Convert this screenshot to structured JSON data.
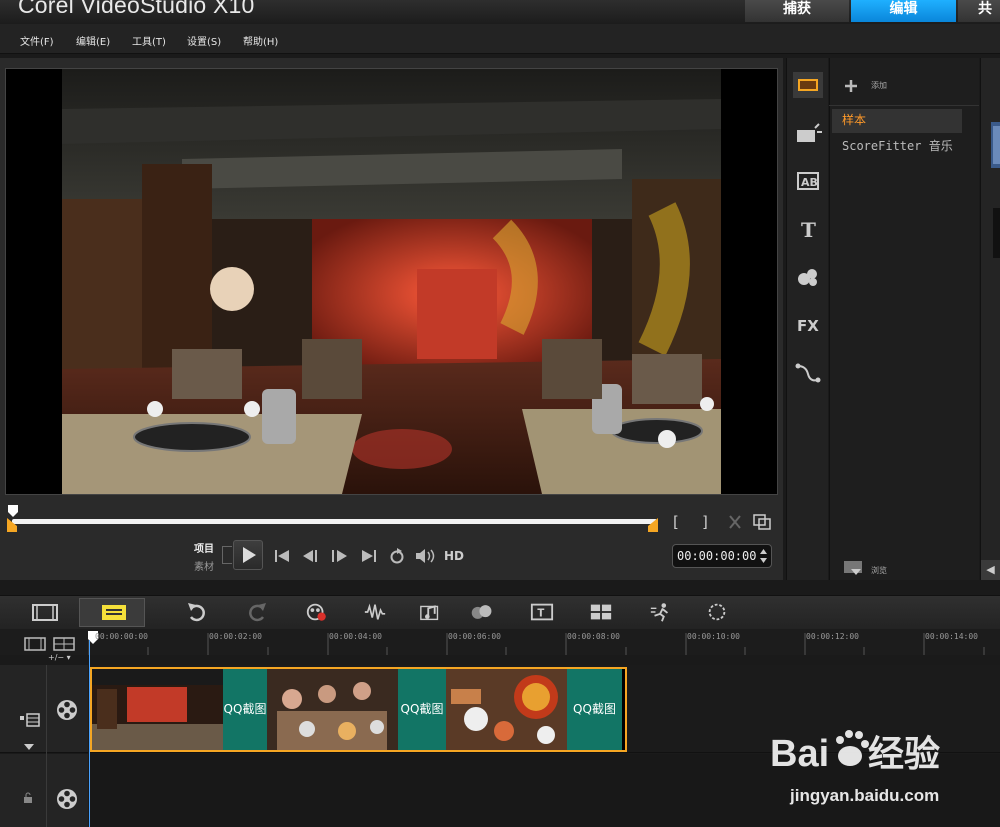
{
  "app": {
    "title": "Corel VideoStudio X10"
  },
  "mode_tabs": {
    "capture": "捕获",
    "edit": "编辑",
    "share": "共"
  },
  "menu": [
    "文件(F)",
    "编辑(E)",
    "工具(T)",
    "设置(S)",
    "帮助(H)"
  ],
  "player": {
    "mode_project": "项目",
    "mode_clip": "素材",
    "hd_label": "HD",
    "timecode": "00:00:00:00",
    "mark_in": "[",
    "mark_out": "]"
  },
  "library": {
    "add_label": "添加",
    "items": [
      "样本",
      "ScoreFitter 音乐"
    ],
    "browse_label": "浏览",
    "scroll_left": "◀"
  },
  "timeline": {
    "zoom_label": "+/−",
    "ruler_ticks": [
      "00:00:00:00",
      "00:00:02:00",
      "00:00:04:00",
      "00:00:06:00",
      "00:00:08:00",
      "00:00:10:00",
      "00:00:12:00",
      "00:00:14:00"
    ],
    "transition_label": "QQ截图"
  },
  "watermark": {
    "logo_text": "Baidu经验",
    "url": "jingyan.baidu.com"
  },
  "colors": {
    "accent_blue": "#0a86da",
    "clip_border": "#f5a623",
    "transition_fill": "#127565",
    "selected_item": "#ff9a2a"
  }
}
